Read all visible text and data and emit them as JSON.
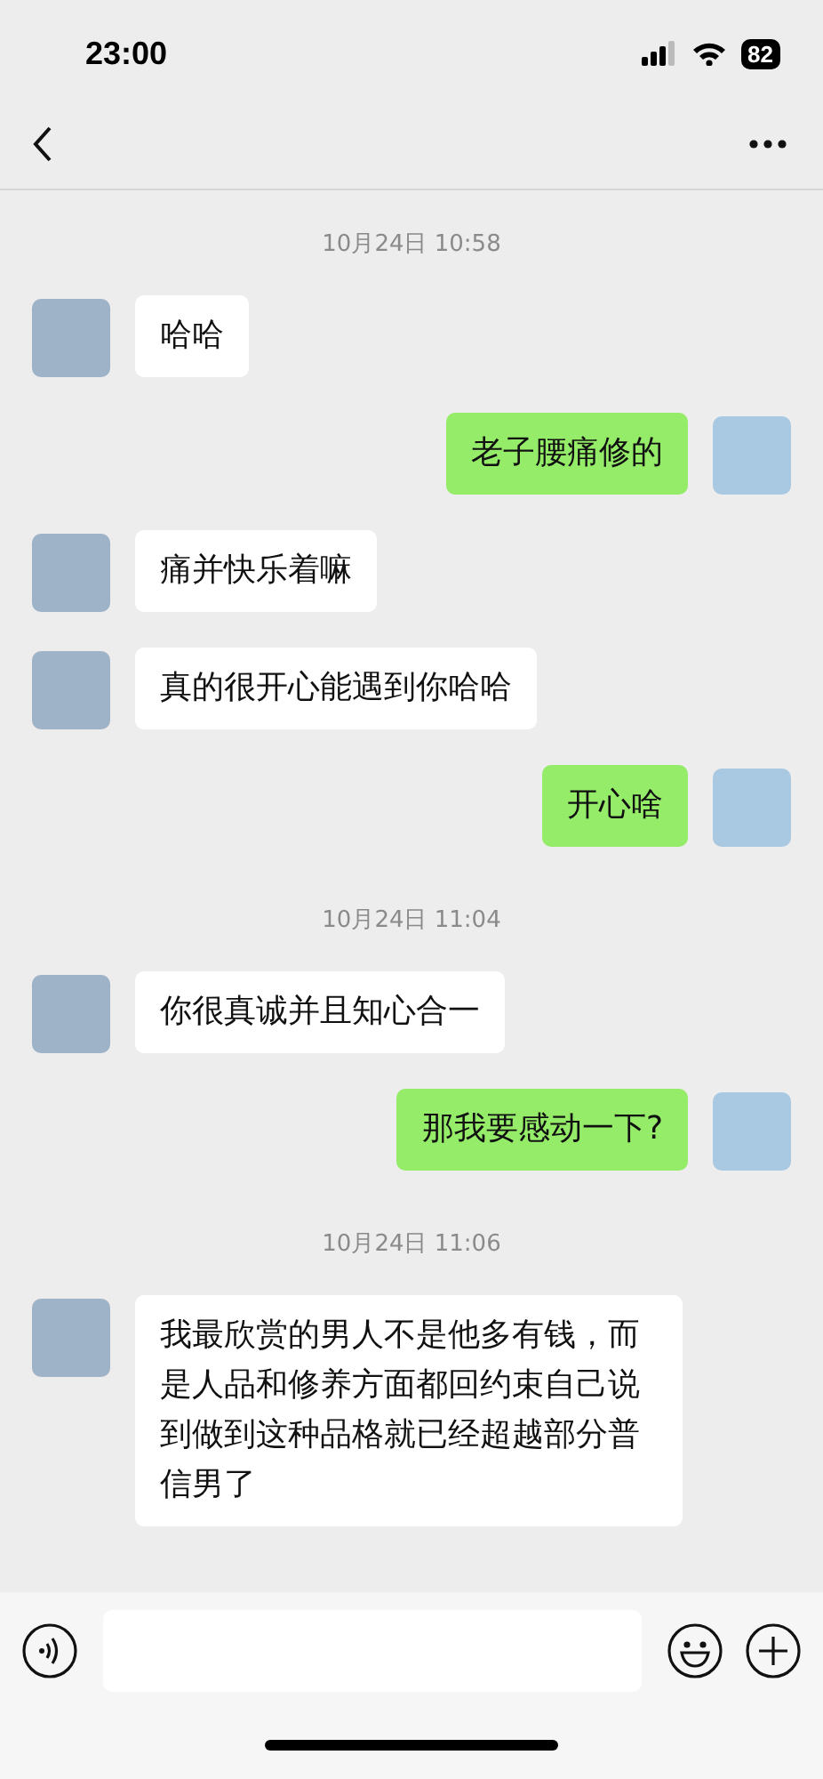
{
  "status_bar": {
    "time": "23:00",
    "battery": "82"
  },
  "messages": [
    {
      "kind": "time",
      "text": "10月24日 10:58"
    },
    {
      "kind": "message",
      "outgoing": false,
      "text": "哈哈"
    },
    {
      "kind": "message",
      "outgoing": true,
      "text": "老子腰痛修的"
    },
    {
      "kind": "message",
      "outgoing": false,
      "text": "痛并快乐着嘛"
    },
    {
      "kind": "message",
      "outgoing": false,
      "text": "真的很开心能遇到你哈哈"
    },
    {
      "kind": "message",
      "outgoing": true,
      "text": "开心啥"
    },
    {
      "kind": "time",
      "text": "10月24日 11:04"
    },
    {
      "kind": "message",
      "outgoing": false,
      "text": "你很真诚并且知心合一"
    },
    {
      "kind": "message",
      "outgoing": true,
      "text": "那我要感动一下?"
    },
    {
      "kind": "time",
      "text": "10月24日 11:06"
    },
    {
      "kind": "message",
      "outgoing": false,
      "text": "我最欣赏的男人不是他多有钱，而是人品和修养方面都回约束自己说到做到这种品格就已经超越部分普信男了"
    }
  ]
}
